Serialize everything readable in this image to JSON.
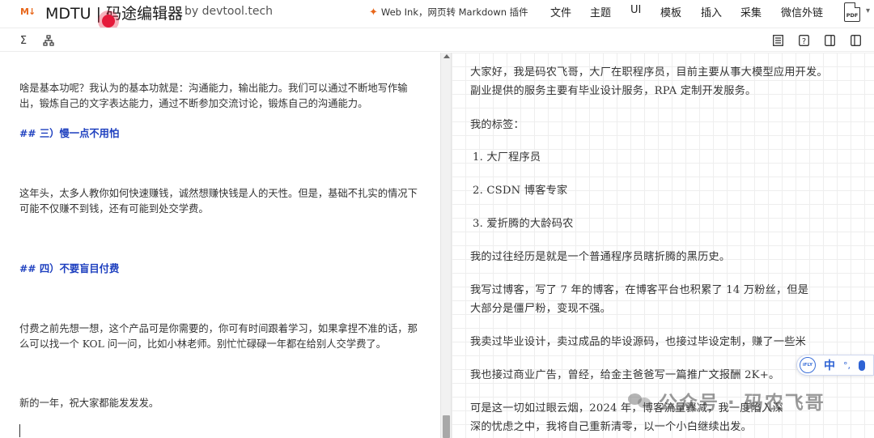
{
  "header": {
    "logo_text": "M↓",
    "title": "MDTU | 码途编辑器",
    "by": "by devtool.tech",
    "promo": "Web Ink，网页转 Markdown 插件",
    "menu": [
      "文件",
      "主题",
      "UI",
      "模板",
      "插入",
      "采集",
      "微信外链"
    ],
    "pdf_label": "PDF"
  },
  "toolbar": {
    "sigma": "Σ",
    "tree": "品"
  },
  "editor": {
    "lines": [
      "啥是基本功呢？我认为的基本功就是：沟通能力，输出能力。我们可以通过不断地写作输",
      "出，锻炼自己的文字表达能力，通过不断参加交流讨论，锻炼自己的沟通能力。",
      "## 三）慢一点不用怕",
      "这年头，太多人教你如何快速赚钱，诚然想赚快钱是人的天性。但是，基础不扎实的情况下",
      "可能不仅赚不到钱，还有可能到处交学费。",
      "## 四）不要盲目付费",
      "付费之前先想一想，这个产品可是你需要的，你可有时间跟着学习，如果拿捏不准的话，那",
      "么可以找一个 KOL 问一问，比如小林老师。别忙忙碌碌一年都在给别人交学费了。",
      "新的一年，祝大家都能发发发。"
    ]
  },
  "preview": {
    "lines": [
      "大家好，我是码农飞哥，大厂在职程序员，目前主要从事大模型应用开发。",
      "副业提供的服务主要有毕业设计服务，RPA 定制开发服务。",
      "我的标签：",
      "1. 大厂程序员",
      "2. CSDN 博客专家",
      "3. 爱折腾的大龄码农",
      "我的过往经历是就是一个普通程序员瞎折腾的黑历史。",
      "我写过博客，写了 7 年的博客，在博客平台也积累了 14 万粉丝，但是",
      "大部分是僵尸粉，变现不强。",
      "我卖过毕业设计，卖过成品的毕设源码，也接过毕设定制，赚了一些米",
      "我也接过商业广告，曾经，给金主爸爸写一篇推广文报酬 2K+。",
      "可是这一切如过眼云烟，2024 年，博客流量骤减，我一度陷入深",
      "深的忧虑之中，我将自己重新清零，以一个小白继续出发。"
    ]
  },
  "ime": {
    "logo": "iFLY",
    "zh": "中",
    "dots": "°,"
  },
  "watermark": {
    "sep": "·",
    "text": "公众号 · 码农飞哥"
  },
  "colors": {
    "brand": "#e8671b",
    "heading": "#1d3fbf",
    "record": "#e5193a",
    "ime_blue": "#2f63d4"
  }
}
